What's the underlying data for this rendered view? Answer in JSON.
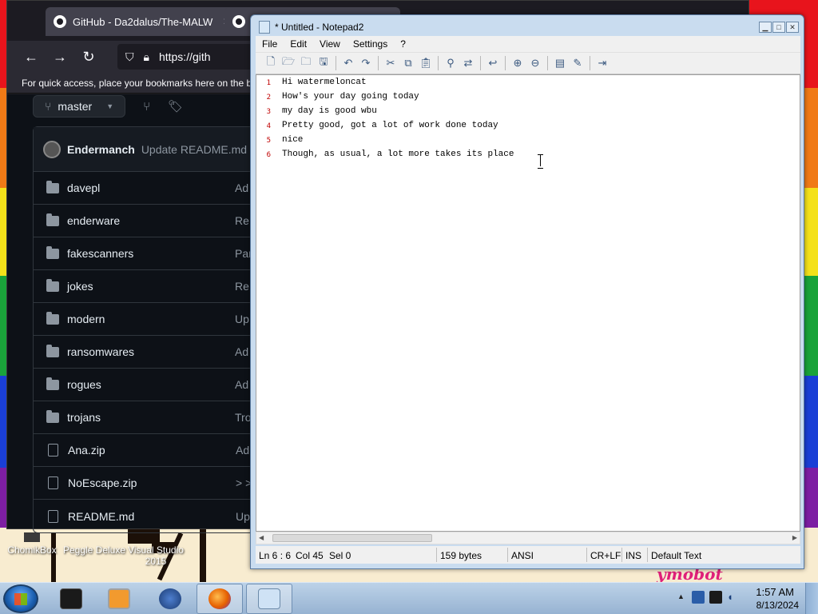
{
  "browser": {
    "tabs": [
      {
        "title": "GitHub - Da2dalus/The-MALW"
      },
      {
        "title": ""
      }
    ],
    "tab_close": "✕",
    "url": "https://gith",
    "bookmarks_hint": "For quick access, place your bookmarks here on the bo",
    "branch": "master",
    "commit": {
      "author": "Endermanch",
      "message": "Update README.md"
    },
    "files": [
      {
        "name": "davepl",
        "type": "folder",
        "msg": "Ad"
      },
      {
        "name": "enderware",
        "type": "folder",
        "msg": "Re"
      },
      {
        "name": "fakescanners",
        "type": "folder",
        "msg": "Par"
      },
      {
        "name": "jokes",
        "type": "folder",
        "msg": "Re"
      },
      {
        "name": "modern",
        "type": "folder",
        "msg": "Up"
      },
      {
        "name": "ransomwares",
        "type": "folder",
        "msg": "Ad"
      },
      {
        "name": "rogues",
        "type": "folder",
        "msg": "Ad"
      },
      {
        "name": "trojans",
        "type": "folder",
        "msg": "Tro"
      },
      {
        "name": "Ana.zip",
        "type": "file",
        "msg": "Ad"
      },
      {
        "name": "NoEscape.zip",
        "type": "file",
        "msg": "> >"
      },
      {
        "name": "README.md",
        "type": "file",
        "msg": "Up"
      }
    ]
  },
  "notepad": {
    "title": "* Untitled - Notepad2",
    "menu": [
      "File",
      "Edit",
      "View",
      "Settings",
      "?"
    ],
    "lines": [
      {
        "num": "1",
        "text": "Hi watermeloncat"
      },
      {
        "num": "2",
        "text": "How's your day going today"
      },
      {
        "num": "3",
        "text": "my day is good wbu"
      },
      {
        "num": "4",
        "text": "Pretty good, got a lot of work done today"
      },
      {
        "num": "5",
        "text": "nice"
      },
      {
        "num": "6",
        "text": "Though, as usual, a lot more takes its place"
      }
    ],
    "status": {
      "position": "Ln 6 : 6",
      "column": "Col 45",
      "selection": "Sel 0",
      "size": "159 bytes",
      "encoding": "ANSI",
      "line_ending": "CR+LF",
      "mode": "INS",
      "scheme": "Default Text"
    }
  },
  "desktop_icons": [
    {
      "label": "ChomikBox"
    },
    {
      "label": "Peggle Deluxe"
    },
    {
      "label": "Visual Studio 2015"
    }
  ],
  "wallpaper_text": "ymobot",
  "clock": {
    "time": "1:57 AM",
    "date": "8/13/2024"
  }
}
